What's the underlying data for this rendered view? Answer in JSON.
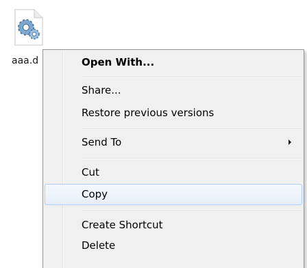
{
  "desktop": {
    "file": {
      "icon": "settings-file-icon",
      "label": "aaa.d"
    }
  },
  "context_menu": {
    "items": [
      {
        "label": "Open With..."
      },
      {
        "label": "Share..."
      },
      {
        "label": "Restore previous versions"
      },
      {
        "label": "Send To"
      },
      {
        "label": "Cut"
      },
      {
        "label": "Copy"
      },
      {
        "label": "Create Shortcut"
      },
      {
        "label": "Delete"
      }
    ],
    "highlighted_item": "Copy",
    "colors": {
      "background": "#f0f0f0",
      "highlight_border": "#aecff7",
      "highlight_fill": "#e6f0fa",
      "border": "#979797"
    }
  }
}
